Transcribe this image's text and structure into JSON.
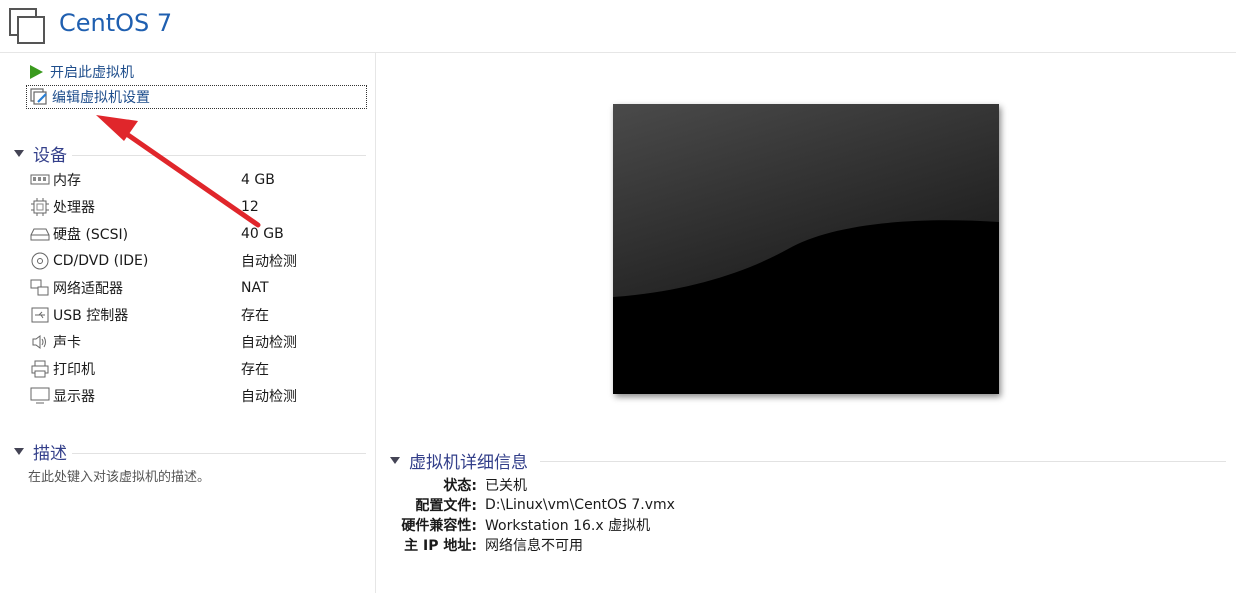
{
  "header": {
    "title": "CentOS 7",
    "icon": "vm-icon"
  },
  "actions": [
    {
      "label": "开启此虚拟机",
      "icon": "play-icon"
    },
    {
      "label": "编辑虚拟机设置",
      "icon": "edit-settings-icon"
    }
  ],
  "devices": {
    "title": "设备",
    "items": [
      {
        "name": "内存",
        "value": "4 GB",
        "icon": "memory-icon"
      },
      {
        "name": "处理器",
        "value": "12",
        "icon": "cpu-icon"
      },
      {
        "name": "硬盘 (SCSI)",
        "value": "40 GB",
        "icon": "hard-disk-icon"
      },
      {
        "name": "CD/DVD (IDE)",
        "value": "自动检测",
        "icon": "cd-dvd-icon"
      },
      {
        "name": "网络适配器",
        "value": "NAT",
        "icon": "network-adapter-icon"
      },
      {
        "name": "USB 控制器",
        "value": "存在",
        "icon": "usb-icon"
      },
      {
        "name": "声卡",
        "value": "自动检测",
        "icon": "speaker-icon"
      },
      {
        "name": "打印机",
        "value": "存在",
        "icon": "printer-icon"
      },
      {
        "name": "显示器",
        "value": "自动检测",
        "icon": "monitor-icon"
      }
    ]
  },
  "description": {
    "title": "描述",
    "placeholder": "在此处键入对该虚拟机的描述。"
  },
  "details": {
    "title": "虚拟机详细信息",
    "rows": [
      {
        "key": "状态:",
        "value": "已关机"
      },
      {
        "key": "配置文件:",
        "value": "D:\\Linux\\vm\\CentOS 7.vmx"
      },
      {
        "key": "硬件兼容性:",
        "value": "Workstation 16.x 虚拟机"
      },
      {
        "key": "主 IP 地址:",
        "value": "网络信息不可用"
      }
    ]
  },
  "colors": {
    "title": "#1f5fb0",
    "section": "#333f8a",
    "arrow": "#e0262b",
    "play": "#3a9a1e"
  }
}
